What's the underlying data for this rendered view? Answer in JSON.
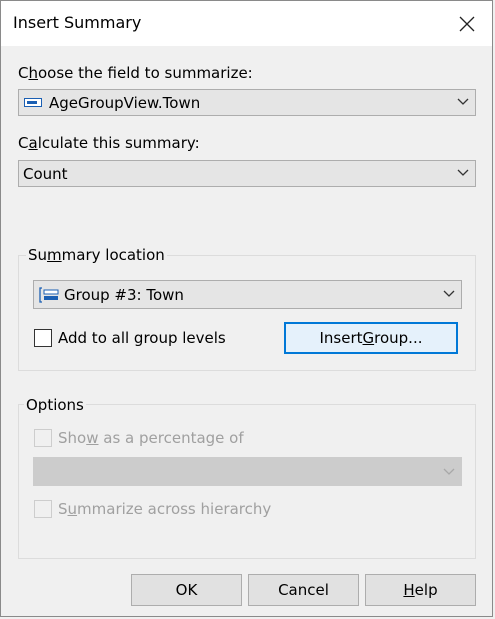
{
  "dialog": {
    "title": "Insert Summary"
  },
  "field": {
    "label_pre": "C",
    "label_u": "h",
    "label_post": "oose the field to summarize:",
    "value": "AgeGroupView.Town"
  },
  "calc": {
    "label_pre": "C",
    "label_u": "a",
    "label_post": "lculate this summary:",
    "value": "Count"
  },
  "location": {
    "group_label_pre": "Su",
    "group_label_u": "m",
    "group_label_post": "mary location",
    "value": "Group #3: Town",
    "add_all_label": "Add to all group levels",
    "insert_group_pre": "Insert ",
    "insert_group_u": "G",
    "insert_group_post": "roup..."
  },
  "options": {
    "group_label": "Options",
    "show_pct_pre": "Sho",
    "show_pct_u": "w",
    "show_pct_post": " as a percentage of",
    "summarize_pre": "S",
    "summarize_u": "u",
    "summarize_post": "mmarize across hierarchy"
  },
  "buttons": {
    "ok": "OK",
    "cancel": "Cancel",
    "help_u": "H",
    "help_post": "elp"
  },
  "colors": {
    "accent": "#0078d7",
    "background": "#f0f0f0"
  }
}
